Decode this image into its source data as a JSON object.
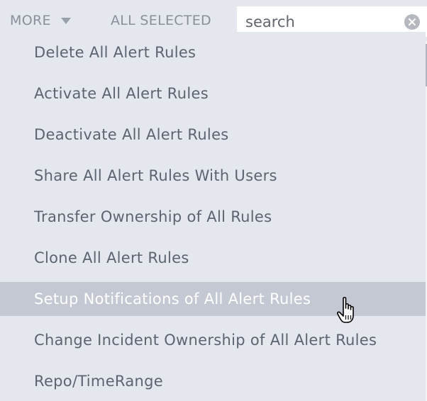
{
  "toolbar": {
    "more_label": "MORE",
    "all_selected_label": "ALL SELECTED"
  },
  "search": {
    "placeholder": "search",
    "value": ""
  },
  "menu": {
    "items": [
      {
        "label": "Delete All Alert Rules"
      },
      {
        "label": "Activate All Alert Rules"
      },
      {
        "label": "Deactivate All Alert Rules"
      },
      {
        "label": "Share All Alert Rules With Users"
      },
      {
        "label": "Transfer Ownership of All Rules"
      },
      {
        "label": "Clone All Alert Rules"
      },
      {
        "label": "Setup Notifications of All Alert Rules",
        "highlighted": true
      },
      {
        "label": "Change Incident Ownership of All Alert Rules"
      },
      {
        "label": "Repo/TimeRange"
      }
    ]
  },
  "colors": {
    "background": "#e4e7ee",
    "text": "#5c6470",
    "highlight_bg": "#c4c8d3",
    "highlight_text": "#ffffff",
    "toolbar_text": "#8a8f99"
  },
  "icons": {
    "more_caret": "chevron-down-icon",
    "clear_search": "close-icon",
    "cursor": "hand-pointer-icon"
  }
}
